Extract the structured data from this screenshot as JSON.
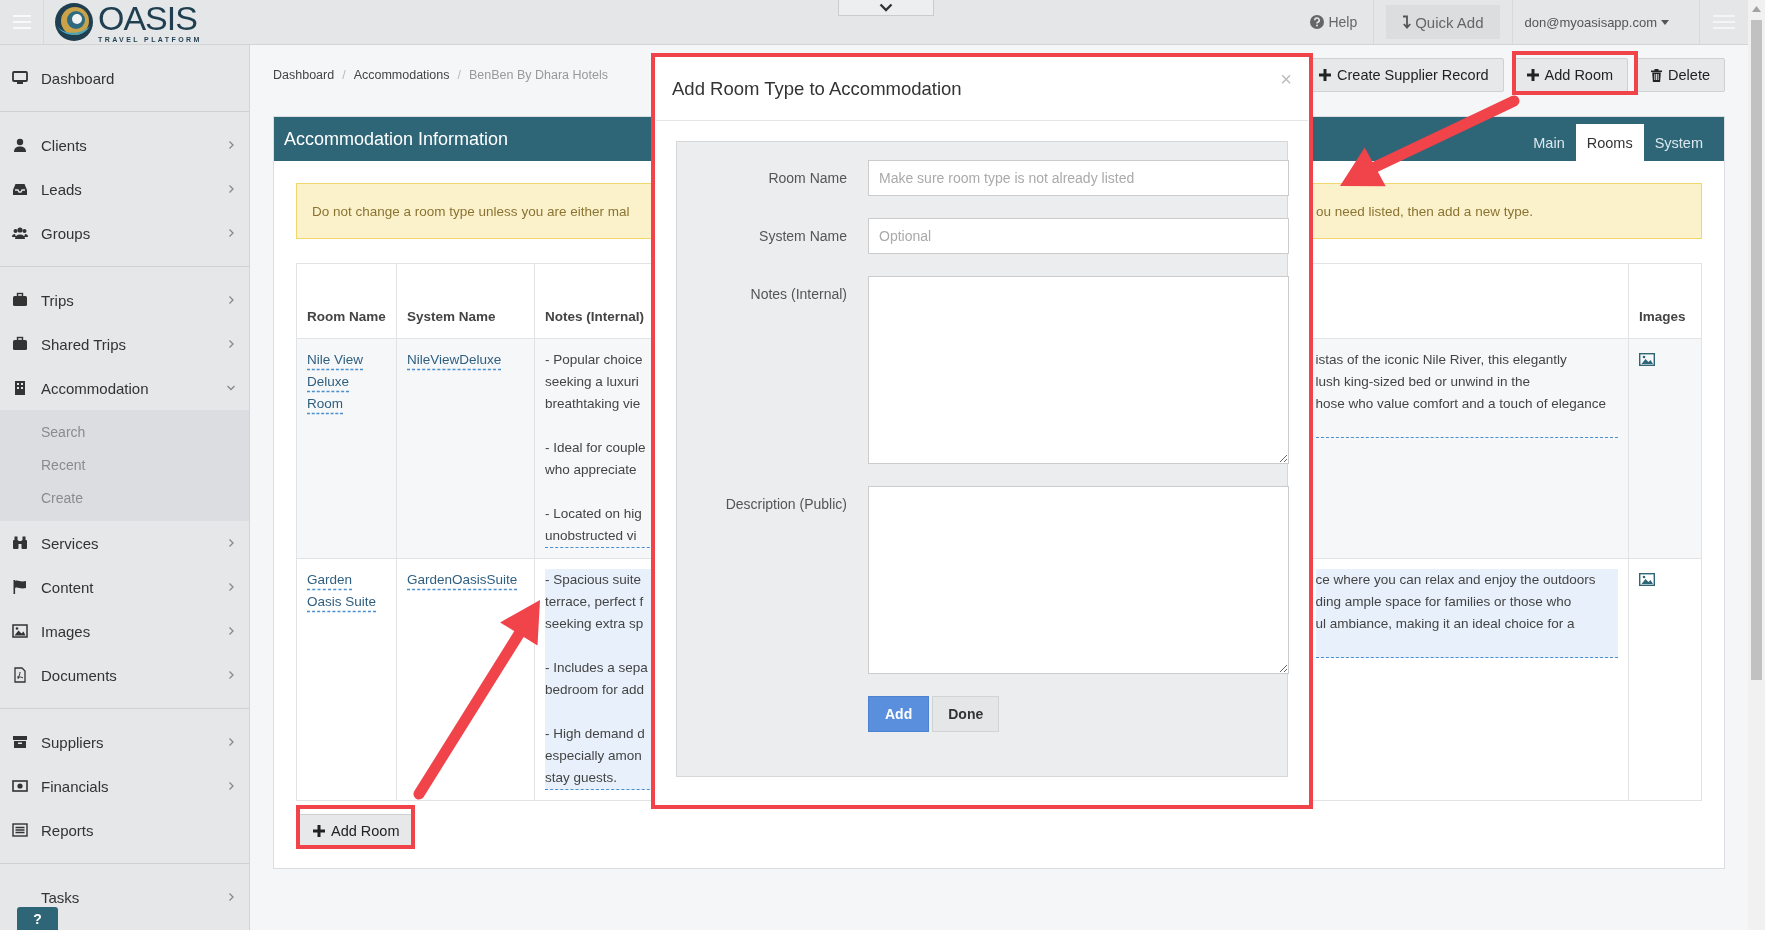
{
  "header": {
    "logo": {
      "name": "OASIS",
      "tagline": "TRAVEL PLATFORM"
    },
    "nav": [
      {
        "kind": "help",
        "label": "Help"
      },
      {
        "kind": "quick-add",
        "label": "Quick Add"
      },
      {
        "kind": "user",
        "label": "don@myoasisapp.com"
      }
    ]
  },
  "sidebar": {
    "sections": [
      {
        "items": [
          {
            "label": "Dashboard",
            "kind": "link"
          }
        ]
      },
      {
        "items": [
          {
            "label": "Clients",
            "kind": "menu",
            "expanded": false
          },
          {
            "label": "Leads",
            "kind": "menu",
            "expanded": false
          },
          {
            "label": "Groups",
            "kind": "menu",
            "expanded": false
          }
        ]
      },
      {
        "items": [
          {
            "label": "Trips",
            "kind": "menu",
            "expanded": false
          },
          {
            "label": "Shared Trips",
            "kind": "menu",
            "expanded": false
          },
          {
            "label": "Accommodation",
            "kind": "menu",
            "expanded": true,
            "children": [
              {
                "label": "Search"
              },
              {
                "label": "Recent"
              },
              {
                "label": "Create"
              }
            ]
          },
          {
            "label": "Services",
            "kind": "menu",
            "expanded": false
          },
          {
            "label": "Content",
            "kind": "menu",
            "expanded": false
          },
          {
            "label": "Images",
            "kind": "menu",
            "expanded": false
          },
          {
            "label": "Documents",
            "kind": "menu",
            "expanded": false
          }
        ]
      },
      {
        "items": [
          {
            "label": "Suppliers",
            "kind": "menu",
            "expanded": false
          },
          {
            "label": "Financials",
            "kind": "menu",
            "expanded": false
          },
          {
            "label": "Reports",
            "kind": "link"
          }
        ]
      },
      {
        "items": [
          {
            "label": "Tasks",
            "kind": "menu",
            "expanded": false
          }
        ]
      }
    ]
  },
  "help_button": {
    "label": "?"
  },
  "breadcrumb": [
    "Dashboard",
    "Accommodations",
    "BenBen By Dhara Hotels"
  ],
  "breadcrumb_separator": "/",
  "actions": [
    {
      "kind": "add",
      "label": "Create Supplier Record"
    },
    {
      "kind": "add",
      "label": "Add Room"
    },
    {
      "kind": "delete",
      "label": "Delete"
    }
  ],
  "panel": {
    "title": "Accommodation Information",
    "tabs": [
      {
        "label": "Main",
        "selected": false
      },
      {
        "label": "Rooms",
        "selected": true
      },
      {
        "label": "System",
        "selected": false
      }
    ],
    "alert": [
      "Do not change a room type unless you are either mal",
      "ou need listed, then add a new type."
    ],
    "table": {
      "columns": [
        "Room Name",
        "System Name",
        "Notes (Internal)",
        "Images"
      ],
      "rows": [
        {
          "room_name": "Nile View Deluxe Room",
          "system_name": "NileViewDeluxe",
          "highlighted": false,
          "notes": [
            [
              "- Popular choice",
              "seeking a luxuri",
              "breathtaking vie"
            ],
            [
              "- Ideal for couple",
              "who appreciate"
            ],
            [
              "- Located on hig",
              "unobstructed vi"
            ]
          ],
          "description": [
            "istas of the iconic Nile River, this elegantly",
            "lush king-sized bed or unwind in the",
            "hose who value comfort and a touch of elegance"
          ]
        },
        {
          "room_name": "Garden Oasis Suite",
          "system_name": "GardenOasisSuite",
          "highlighted": true,
          "notes": [
            [
              "- Spacious suite",
              "terrace, perfect f",
              "seeking extra sp"
            ],
            [
              "- Includes a sepa",
              "bedroom for add"
            ],
            [
              "- High demand d",
              "especially amon",
              "stay guests."
            ]
          ],
          "description": [
            "ce where you can relax and enjoy the outdoors",
            "ding ample space for families or those who",
            "ul ambiance, making it an ideal choice for a"
          ]
        }
      ]
    },
    "add_button": {
      "label": "Add Room"
    }
  },
  "modal": {
    "title": "Add Room Type to Accommodation",
    "close": "×",
    "fields": [
      {
        "kind": "input",
        "label": "Room Name",
        "placeholder": "Make sure room type is not already listed"
      },
      {
        "kind": "input",
        "label": "System Name",
        "placeholder": "Optional"
      },
      {
        "kind": "textarea",
        "label": "Notes (Internal)"
      },
      {
        "kind": "textarea",
        "label": "Description (Public)"
      }
    ],
    "buttons": [
      {
        "kind": "primary",
        "label": "Add"
      },
      {
        "kind": "default",
        "label": "Done"
      }
    ]
  }
}
